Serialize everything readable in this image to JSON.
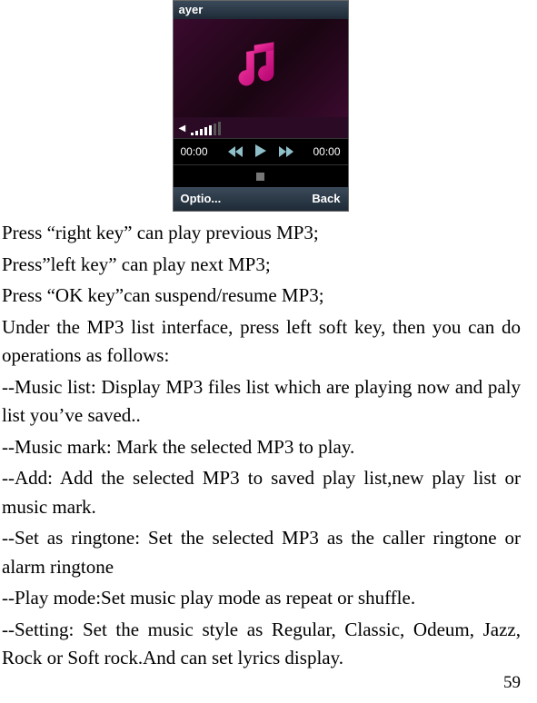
{
  "phone": {
    "title_fragment": "ayer",
    "time_left": "00:00",
    "time_right": "00:00",
    "soft_left": "Optio...",
    "soft_right": "Back"
  },
  "body": {
    "p1": "Press “right key” can play previous MP3;",
    "p2": "Press”left key” can play next MP3;",
    "p3": "Press “OK key”can suspend/resume MP3;",
    "p4": "Under the MP3 list interface, press left soft key, then you can do operations as follows:",
    "p5": "--Music list: Display MP3 files list which are playing now and paly list you’ve saved..",
    "p6": "--Music mark: Mark the selected MP3 to play.",
    "p7": "--Add: Add the selected MP3 to saved play list,new play list or music mark.",
    "p8": "--Set as ringtone: Set the selected MP3 as the caller ringtone or alarm ringtone",
    "p9": "--Play mode:Set music play mode as repeat or shuffle.",
    "p10": "--Setting: Set the music style as Regular, Classic, Odeum, Jazz, Rock or Soft rock.And can set lyrics display."
  },
  "page_number": "59"
}
